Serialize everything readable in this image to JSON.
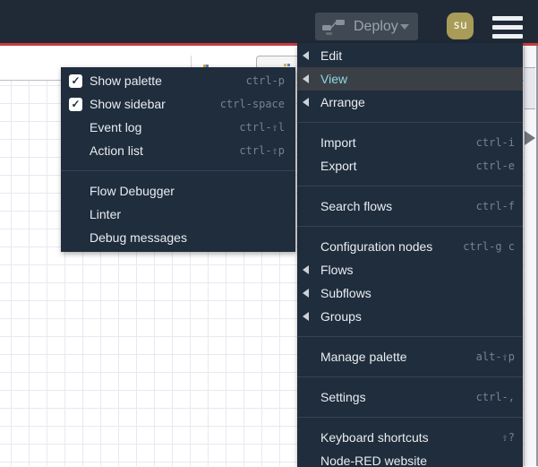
{
  "header": {
    "deploy_label": "Deploy",
    "user_badge": "su",
    "icons": [
      "deploy-node-icon",
      "chevron-down-icon",
      "hamburger-menu-icon"
    ]
  },
  "main_menu": {
    "items": [
      {
        "label": "Edit",
        "submenu": true
      },
      {
        "label": "View",
        "submenu": true,
        "active": true
      },
      {
        "label": "Arrange",
        "submenu": true
      },
      {
        "separator": true
      },
      {
        "label": "Import",
        "shortcut": "ctrl-i"
      },
      {
        "label": "Export",
        "shortcut": "ctrl-e"
      },
      {
        "separator": true
      },
      {
        "label": "Search flows",
        "shortcut": "ctrl-f"
      },
      {
        "separator": true
      },
      {
        "label": "Configuration nodes",
        "shortcut": "ctrl-g c"
      },
      {
        "label": "Flows",
        "submenu": true
      },
      {
        "label": "Subflows",
        "submenu": true
      },
      {
        "label": "Groups",
        "submenu": true
      },
      {
        "separator": true
      },
      {
        "label": "Manage palette",
        "shortcut": "alt-⇧p"
      },
      {
        "separator": true
      },
      {
        "label": "Settings",
        "shortcut": "ctrl-,"
      },
      {
        "separator": true
      },
      {
        "label": "Keyboard shortcuts",
        "shortcut": "⇧?"
      },
      {
        "label": "Node-RED website"
      }
    ]
  },
  "view_submenu": {
    "items": [
      {
        "label": "Show palette",
        "checked": true,
        "shortcut": "ctrl-p"
      },
      {
        "label": "Show sidebar",
        "checked": true,
        "shortcut": "ctrl-space"
      },
      {
        "label": "Event log",
        "shortcut": "ctrl-⇧l"
      },
      {
        "label": "Action list",
        "shortcut": "ctrl-⇧p"
      },
      {
        "separator": true
      },
      {
        "label": "Flow Debugger"
      },
      {
        "label": "Linter"
      },
      {
        "label": "Debug messages"
      }
    ]
  },
  "checkbox_glyph": "✓",
  "colors": {
    "header_bg": "#202a37",
    "menu_bg": "#1f2d3d",
    "accent_red": "#c53b40",
    "deploy_bg": "#3f4954",
    "avatar_bg": "#a89c58",
    "highlight_text": "#8ed8e4",
    "grid_line": "#e8e8f2"
  }
}
